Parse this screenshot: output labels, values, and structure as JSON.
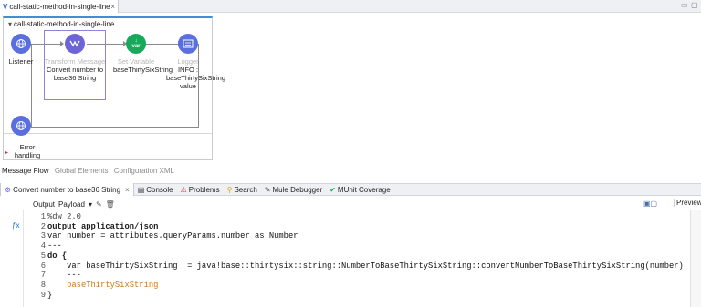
{
  "editor_tab": {
    "label": "call-static-method-in-single-line",
    "close": "×"
  },
  "flow": {
    "name": "call-static-method-in-single-line",
    "nodes": [
      {
        "type": "",
        "label": "Listener"
      },
      {
        "type": "Transform Message",
        "label": "Convert number to base36 String"
      },
      {
        "type": "Set Variable",
        "label": "baseThirtySixString"
      },
      {
        "type": "Logger",
        "label": "INFO : baseThirtySixString value"
      }
    ],
    "error_handler": {
      "label": "Error handling"
    }
  },
  "flow_tabs": [
    "Message Flow",
    "Global Elements",
    "Configuration XML"
  ],
  "panel_tabs": [
    {
      "label": "Convert number to base36 String",
      "icon": "transform-icon",
      "close": "×"
    },
    {
      "label": "Console",
      "icon": "console-icon"
    },
    {
      "label": "Problems",
      "icon": "problems-icon"
    },
    {
      "label": "Search",
      "icon": "search-icon"
    },
    {
      "label": "Mule Debugger",
      "icon": "debugger-icon"
    },
    {
      "label": "MUnit Coverage",
      "icon": "coverage-icon"
    }
  ],
  "output_bar": {
    "label": "Output",
    "selected": "Payload"
  },
  "preview": "Preview",
  "code": {
    "lines": [
      {
        "n": "1",
        "text": "%dw 2.0"
      },
      {
        "n": "2",
        "text": "output application/json"
      },
      {
        "n": "3",
        "text": "var number = attributes.queryParams.number as Number"
      },
      {
        "n": "4",
        "text": "---"
      },
      {
        "n": "5",
        "text": "do {"
      },
      {
        "n": "6",
        "text": "    var baseThirtySixString  = java!base::thirtysix::string::NumberToBaseThirtySixString::convertNumberToBaseThirtySixString(number)"
      },
      {
        "n": "7",
        "text": "    ---"
      },
      {
        "n": "8",
        "text": "    baseThirtySixString"
      },
      {
        "n": "9",
        "text": "}"
      }
    ]
  },
  "colors": {
    "listener": "#5a6ee0",
    "transform": "#6d64d8",
    "set_variable": "#17a85a",
    "logger": "#5a6ee0",
    "accent": "#3f8fd6"
  }
}
